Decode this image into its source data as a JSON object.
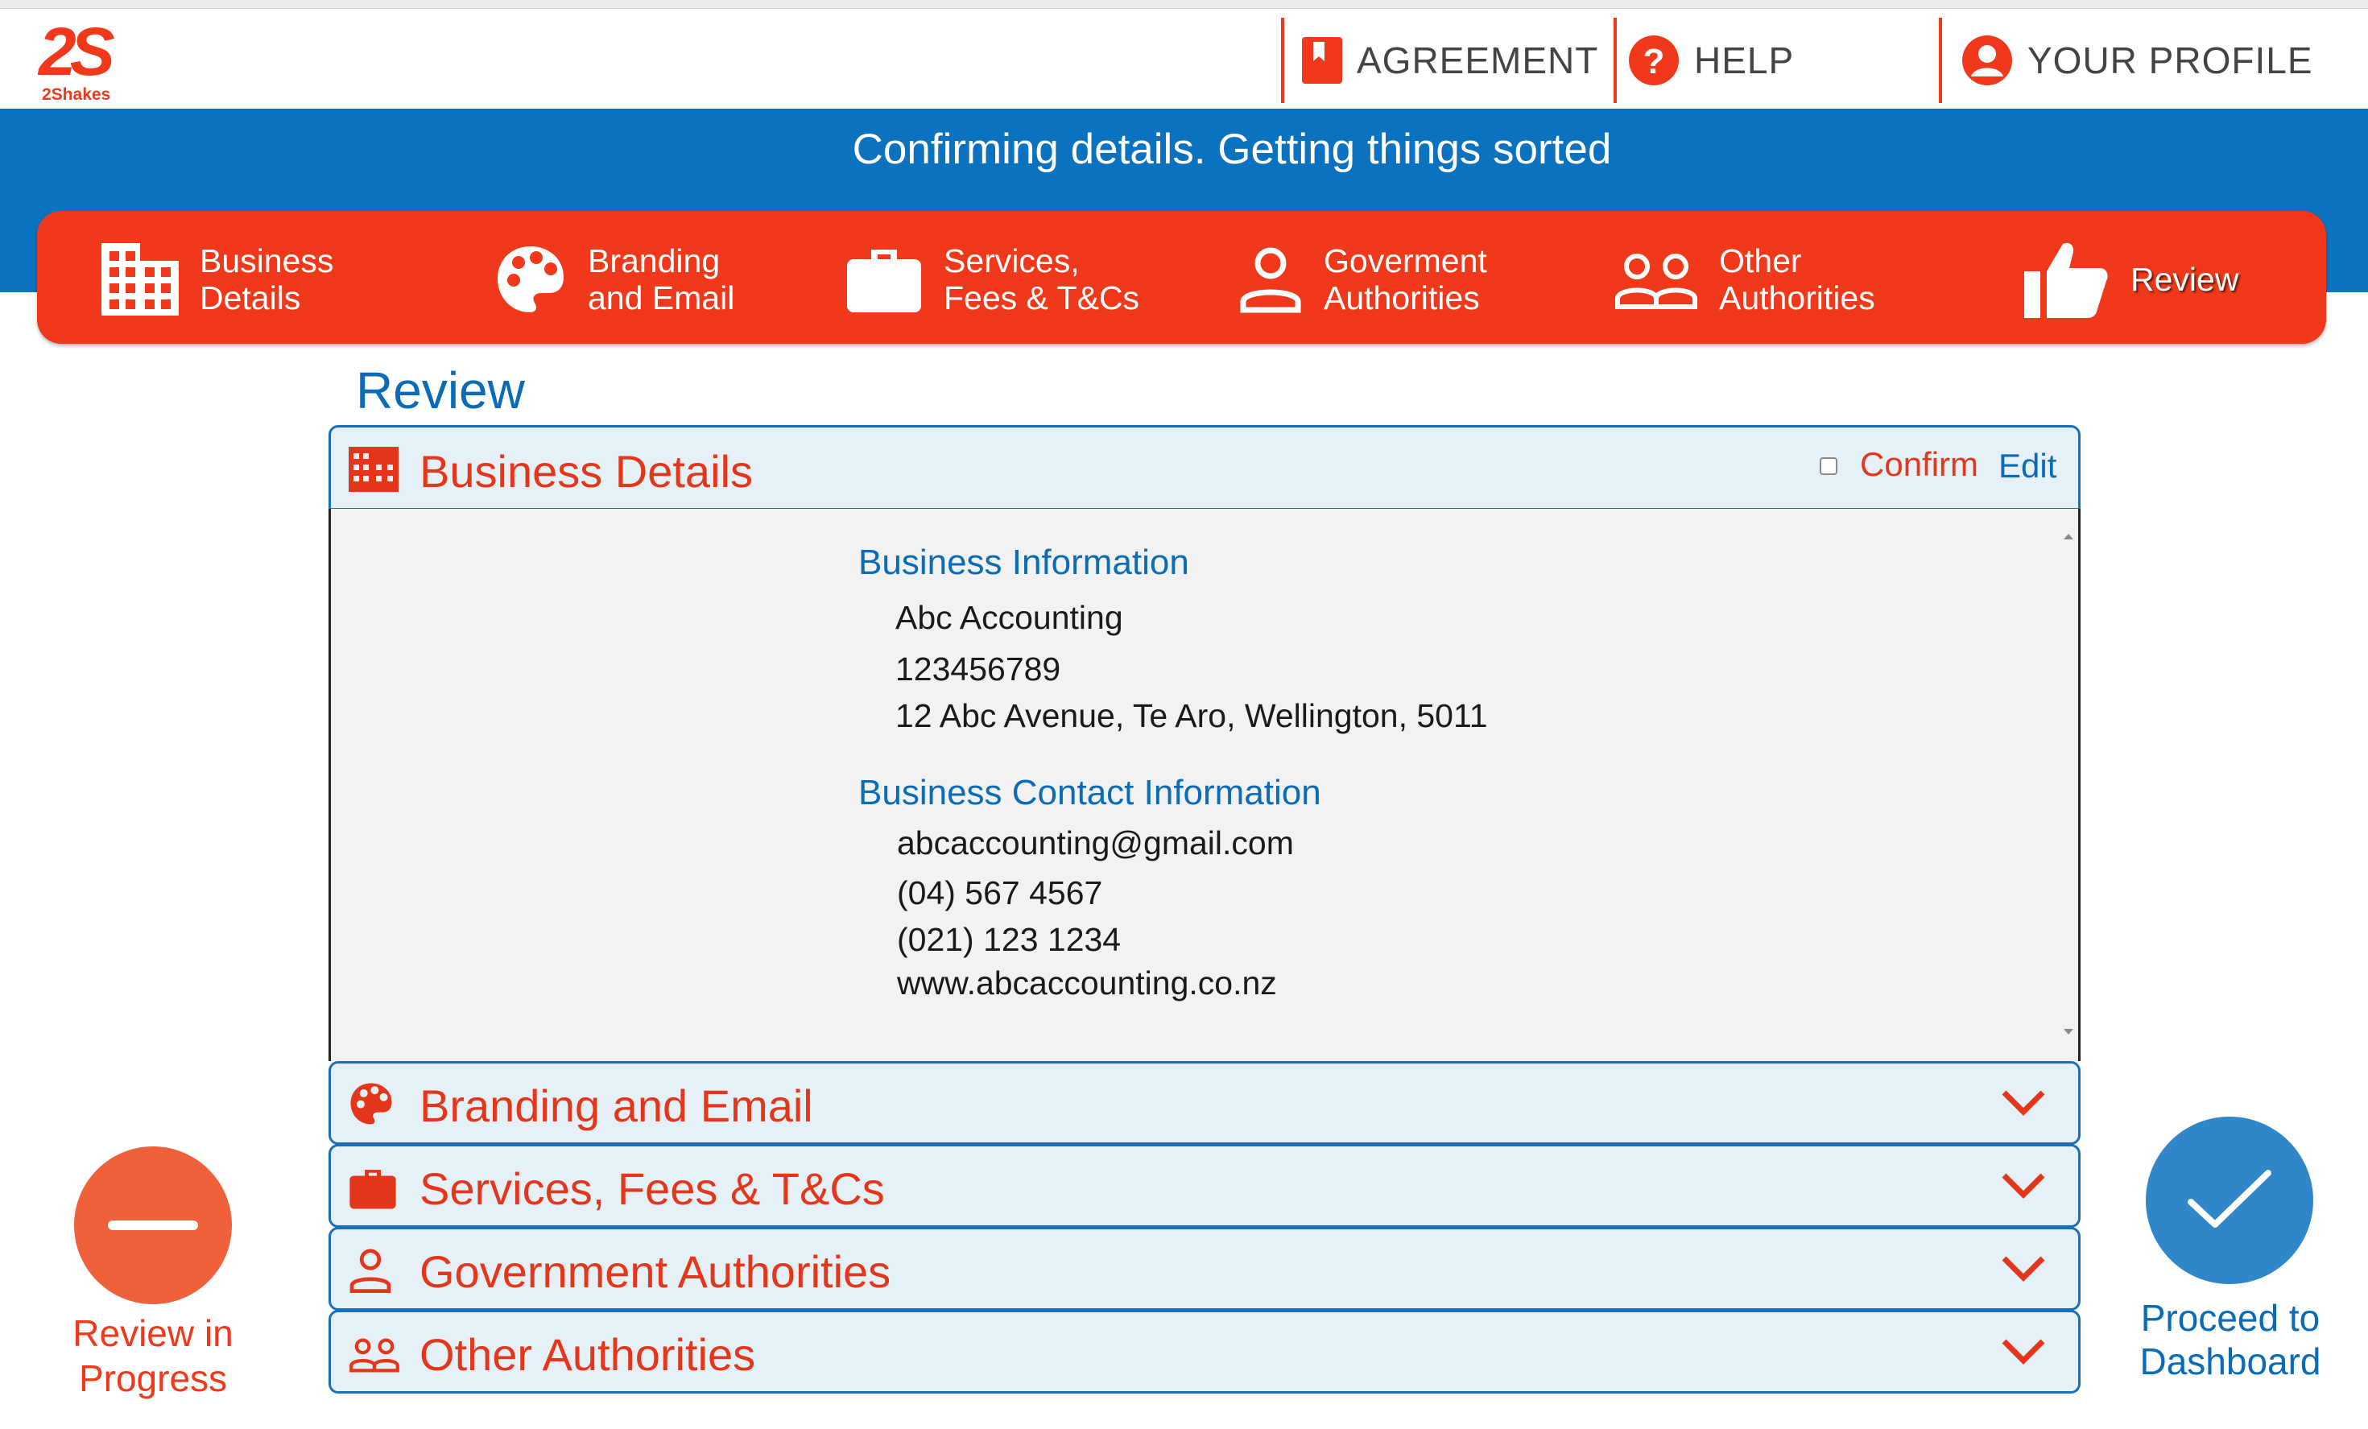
{
  "brand": {
    "logo_mark": "2S",
    "logo_text": "2Shakes"
  },
  "header_nav": {
    "agreement": "AGREEMENT",
    "help": "HELP",
    "profile": "YOUR PROFILE"
  },
  "banner": {
    "title": "Confirming details. Getting things sorted"
  },
  "steps": [
    {
      "line1": "Business",
      "line2": "Details",
      "icon": "building-icon"
    },
    {
      "line1": "Branding",
      "line2": "and Email",
      "icon": "palette-icon"
    },
    {
      "line1": "Services,",
      "line2": "Fees & T&Cs",
      "icon": "briefcase-icon"
    },
    {
      "line1": "Goverment",
      "line2": "Authorities",
      "icon": "user-icon"
    },
    {
      "line1": "Other",
      "line2": "Authorities",
      "icon": "users-icon"
    },
    {
      "line1": "Review",
      "line2": "",
      "icon": "thumbs-up-icon"
    }
  ],
  "page": {
    "heading": "Review"
  },
  "business_panel": {
    "title": "Business Details",
    "confirm_label": "Confirm",
    "edit_label": "Edit",
    "sections": {
      "business_info": {
        "heading": "Business Information",
        "name": "Abc Accounting",
        "number": "123456789",
        "address": "12 Abc Avenue, Te Aro, Wellington, 5011"
      },
      "contact_info": {
        "heading": "Business Contact Information",
        "email": "abcaccounting@gmail.com",
        "phone": "(04) 567 4567",
        "mobile": "(021) 123 1234",
        "website": "www.abcaccounting.co.nz"
      }
    }
  },
  "collapsed_panels": [
    {
      "title": "Branding and Email",
      "icon": "palette-icon"
    },
    {
      "title": "Services, Fees & T&Cs",
      "icon": "briefcase-icon"
    },
    {
      "title": "Government Authorities",
      "icon": "user-icon"
    },
    {
      "title": "Other Authorities",
      "icon": "users-icon"
    }
  ],
  "actions": {
    "review_status_line1": "Review in",
    "review_status_line2": "Progress",
    "proceed_line1": "Proceed to",
    "proceed_line2": "Dashboard"
  },
  "colors": {
    "accent": "#f0381a",
    "blue": "#0a72bf",
    "panel_bg": "#e6f0f7"
  }
}
